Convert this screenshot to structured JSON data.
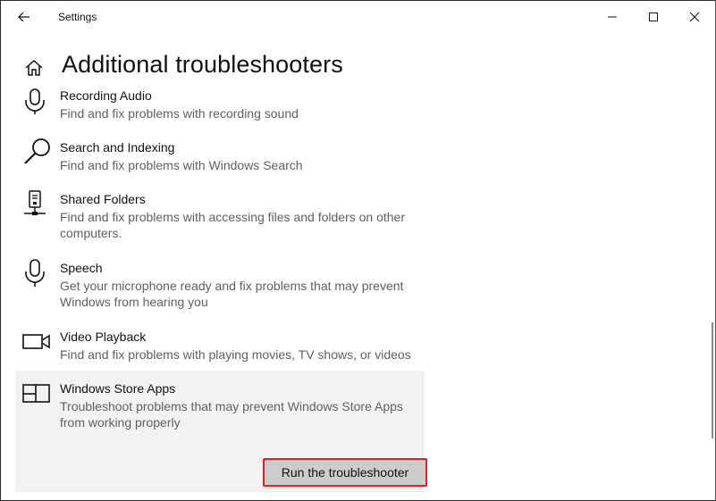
{
  "window": {
    "title": "Settings",
    "controls": {
      "minimize": "minimize-icon",
      "maximize": "maximize-icon",
      "close": "close-icon"
    }
  },
  "header": {
    "back_icon": "back-arrow-icon",
    "home_icon": "home-icon",
    "title": "Additional troubleshooters"
  },
  "troubleshooters": [
    {
      "icon": "microphone-icon",
      "name": "Recording Audio",
      "description": "Find and fix problems with recording sound"
    },
    {
      "icon": "search-icon",
      "name": "Search and Indexing",
      "description": "Find and fix problems with Windows Search"
    },
    {
      "icon": "shared-folders-icon",
      "name": "Shared Folders",
      "description": "Find and fix problems with accessing files and folders on other computers."
    },
    {
      "icon": "microphone-icon",
      "name": "Speech",
      "description": "Get your microphone ready and fix problems that may prevent Windows from hearing you"
    },
    {
      "icon": "video-camera-icon",
      "name": "Video Playback",
      "description": "Find and fix problems with playing movies, TV shows, or videos"
    },
    {
      "icon": "store-apps-icon",
      "name": "Windows Store Apps",
      "description": "Troubleshoot problems that may prevent Windows Store Apps from working properly",
      "selected": true
    }
  ],
  "run_button": {
    "label": "Run the troubleshooter"
  },
  "colors": {
    "highlight_border": "#e02020",
    "selected_bg": "#f2f2f2",
    "button_bg": "#cccccc"
  }
}
